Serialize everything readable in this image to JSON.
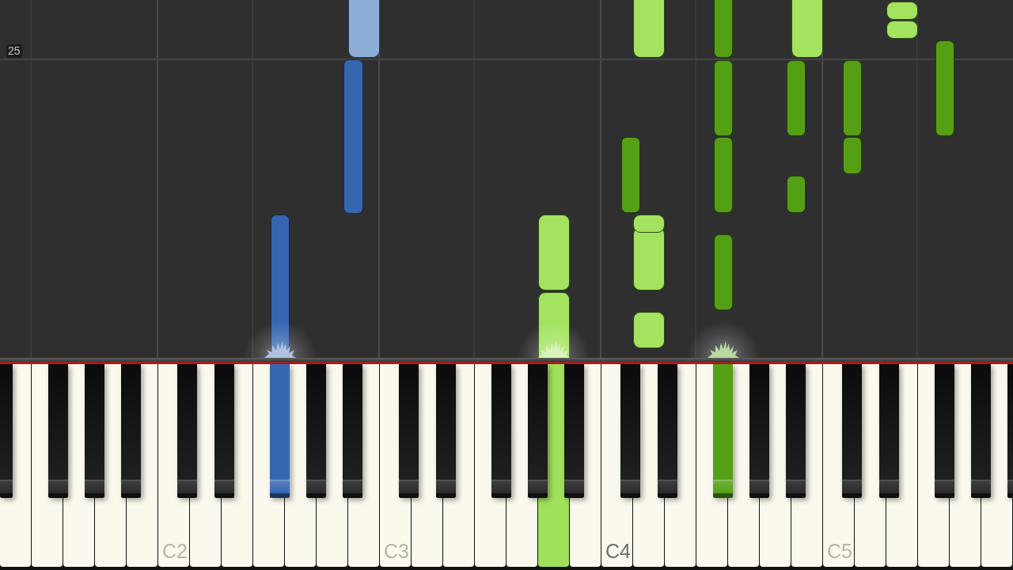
{
  "measure_label": "25",
  "keyboard": {
    "keys": [
      {
        "kind": "black",
        "pressed": false
      },
      {
        "kind": "white",
        "pressed": false
      },
      {
        "kind": "white",
        "pressed": false
      },
      {
        "kind": "black",
        "pressed": false
      },
      {
        "kind": "white",
        "pressed": false
      },
      {
        "kind": "black",
        "pressed": false
      },
      {
        "kind": "white",
        "pressed": false
      },
      {
        "kind": "black",
        "pressed": false
      },
      {
        "kind": "white",
        "pressed": false
      },
      {
        "kind": "white",
        "pressed": false,
        "label": {
          "text": "C2",
          "emphasized": false
        }
      },
      {
        "kind": "black",
        "pressed": false
      },
      {
        "kind": "white",
        "pressed": false
      },
      {
        "kind": "black",
        "pressed": false
      },
      {
        "kind": "white",
        "pressed": false
      },
      {
        "kind": "white",
        "pressed": false
      },
      {
        "kind": "black",
        "pressed": true,
        "color": "#3668b2"
      },
      {
        "kind": "white",
        "pressed": false
      },
      {
        "kind": "black",
        "pressed": false
      },
      {
        "kind": "white",
        "pressed": false
      },
      {
        "kind": "black",
        "pressed": false
      },
      {
        "kind": "white",
        "pressed": false
      },
      {
        "kind": "white",
        "pressed": false,
        "label": {
          "text": "C3",
          "emphasized": false
        }
      },
      {
        "kind": "black",
        "pressed": false
      },
      {
        "kind": "white",
        "pressed": false
      },
      {
        "kind": "black",
        "pressed": false
      },
      {
        "kind": "white",
        "pressed": false
      },
      {
        "kind": "white",
        "pressed": false
      },
      {
        "kind": "black",
        "pressed": false
      },
      {
        "kind": "white",
        "pressed": false
      },
      {
        "kind": "black",
        "pressed": false
      },
      {
        "kind": "white",
        "pressed": true,
        "color": "#a0e15c"
      },
      {
        "kind": "black",
        "pressed": false
      },
      {
        "kind": "white",
        "pressed": false
      },
      {
        "kind": "white",
        "pressed": false,
        "label": {
          "text": "C4",
          "emphasized": true
        }
      },
      {
        "kind": "black",
        "pressed": false
      },
      {
        "kind": "white",
        "pressed": false
      },
      {
        "kind": "black",
        "pressed": false
      },
      {
        "kind": "white",
        "pressed": false
      },
      {
        "kind": "white",
        "pressed": false
      },
      {
        "kind": "black",
        "pressed": true,
        "color": "#55a116"
      },
      {
        "kind": "white",
        "pressed": false
      },
      {
        "kind": "black",
        "pressed": false
      },
      {
        "kind": "white",
        "pressed": false
      },
      {
        "kind": "black",
        "pressed": false
      },
      {
        "kind": "white",
        "pressed": false
      },
      {
        "kind": "white",
        "pressed": false,
        "label": {
          "text": "C5",
          "emphasized": false
        }
      },
      {
        "kind": "black",
        "pressed": false
      },
      {
        "kind": "white",
        "pressed": false
      },
      {
        "kind": "black",
        "pressed": false
      },
      {
        "kind": "white",
        "pressed": false
      },
      {
        "kind": "white",
        "pressed": false
      },
      {
        "kind": "black",
        "pressed": false
      },
      {
        "kind": "white",
        "pressed": false
      },
      {
        "kind": "black",
        "pressed": false
      },
      {
        "kind": "white",
        "pressed": false
      },
      {
        "kind": "black",
        "pressed": false
      }
    ]
  }
}
